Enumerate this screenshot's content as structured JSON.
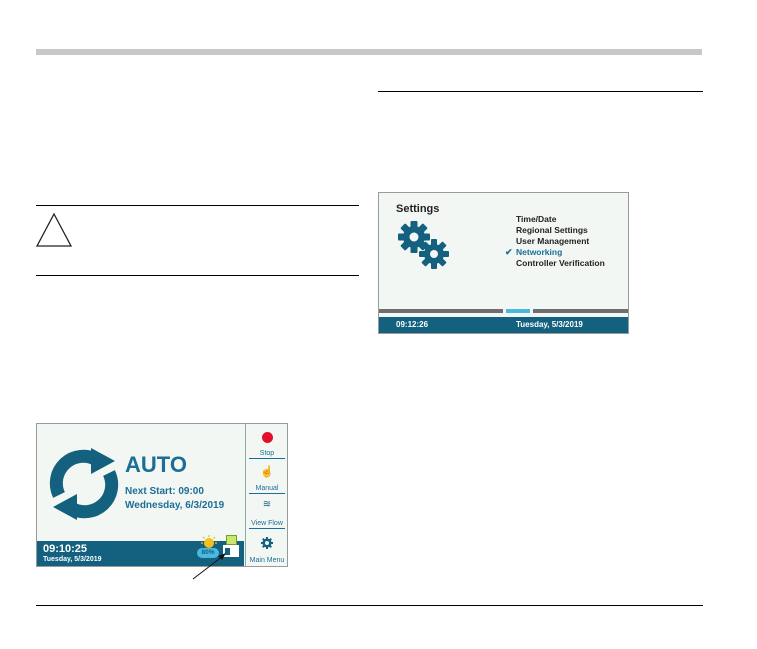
{
  "settings_screen": {
    "title": "Settings",
    "menu": [
      {
        "label": "Time/Date",
        "selected": false
      },
      {
        "label": "Regional Settings",
        "selected": false
      },
      {
        "label": "User Management",
        "selected": false
      },
      {
        "label": "Networking",
        "selected": true
      },
      {
        "label": "Controller Verification",
        "selected": false
      }
    ],
    "footer_time": "09:12:26",
    "footer_date": "Tuesday, 5/3/2019"
  },
  "auto_screen": {
    "mode": "AUTO",
    "next_start": "Next Start: 09:00",
    "next_date": "Wednesday, 6/3/2019",
    "time": "09:10:25",
    "date": "Tuesday, 5/3/2019",
    "weather_percent": "80%",
    "sidebar": {
      "stop": "Stop",
      "manual": "Manual",
      "view_flow": "View Flow",
      "main_menu": "Main Menu"
    }
  },
  "colors": {
    "primary": "#13607f",
    "accent": "#1b6e97",
    "highlight": "#4bb8e0",
    "stop": "#e0102a",
    "screen_bg": "#f3f7f3"
  }
}
